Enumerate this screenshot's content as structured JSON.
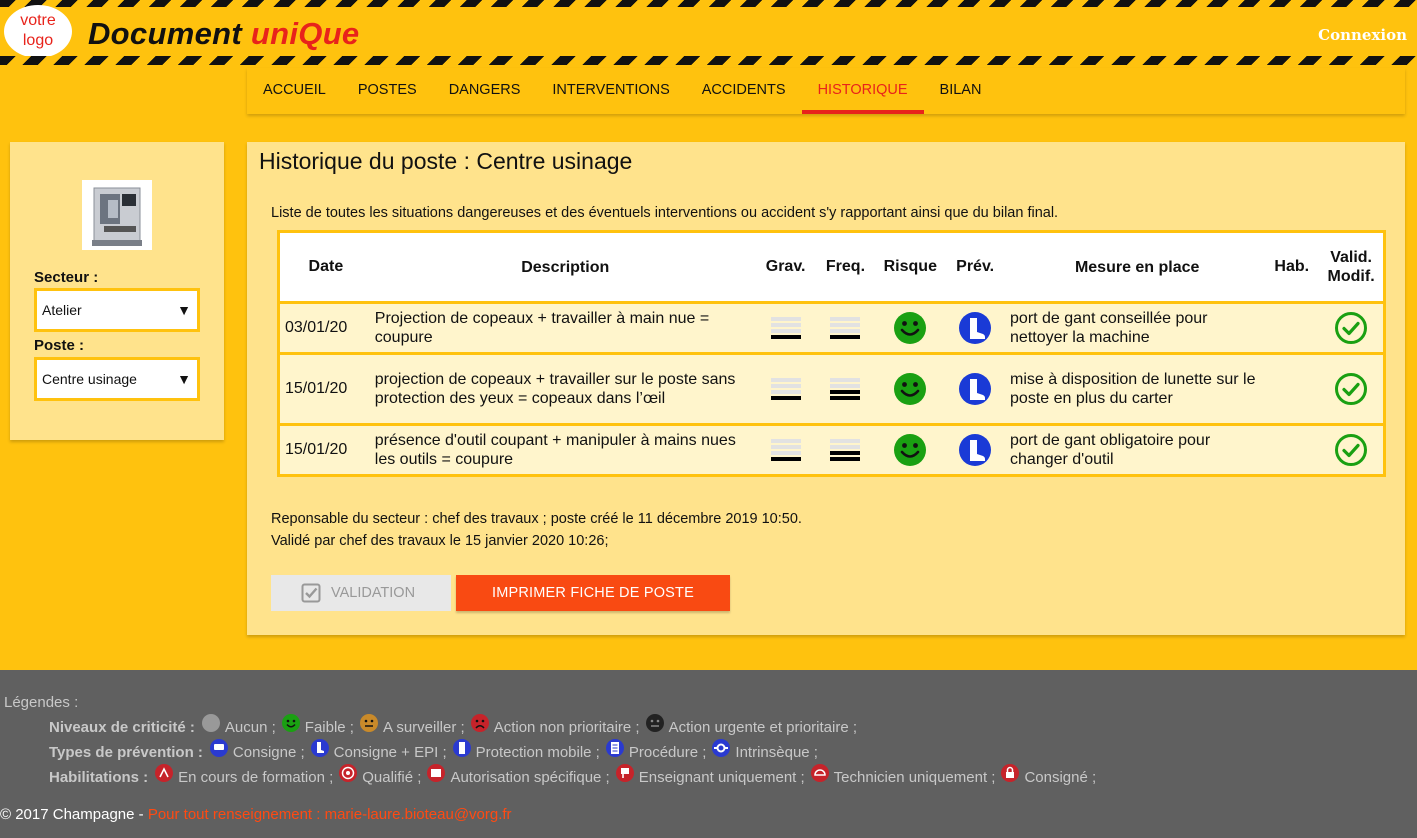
{
  "header": {
    "logo_line1": "votre",
    "logo_line2": "logo",
    "brand_part1": "Document ",
    "brand_part2": "uniQue",
    "login": "Connexion"
  },
  "nav": {
    "items": [
      "ACCUEIL",
      "POSTES",
      "DANGERS",
      "INTERVENTIONS",
      "ACCIDENTS",
      "HISTORIQUE",
      "BILAN"
    ],
    "active": "HISTORIQUE"
  },
  "sidebar": {
    "secteur_label": "Secteur :",
    "secteur_value": "Atelier",
    "poste_label": "Poste :",
    "poste_value": "Centre usinage",
    "caret": "▼"
  },
  "main": {
    "title": "Historique du poste : Centre usinage",
    "intro": "Liste de toutes les situations dangereuses et des éventuels interventions ou accident s'y rapportant ainsi que du bilan final.",
    "columns": {
      "date": "Date",
      "description": "Description",
      "grav": "Grav.",
      "freq": "Freq.",
      "risque": "Risque",
      "prev": "Prév.",
      "mesure": "Mesure en place",
      "hab": "Hab.",
      "valid1": "Valid.",
      "valid2": "Modif."
    },
    "rows": [
      {
        "date": "03/01/20",
        "description": "Projection de copeaux + travailler à main nue = coupure",
        "grav": 1,
        "freq": 1,
        "risque": "faible",
        "prev": "consigne-epi",
        "mesure": "port de gant conseillée pour nettoyer la machine"
      },
      {
        "date": "15/01/20",
        "description": "projection de copeaux + travailler sur le poste sans protection des yeux = copeaux dans l’œil",
        "grav": 1,
        "freq": 2,
        "risque": "faible",
        "prev": "consigne-epi",
        "mesure": "mise à disposition de lunette sur le poste en plus du carter"
      },
      {
        "date": "15/01/20",
        "description": "présence d'outil coupant + manipuler à mains nues les outils = coupure",
        "grav": 1,
        "freq": 2,
        "risque": "faible",
        "prev": "consigne-epi",
        "mesure": "port de gant obligatoire pour changer d'outil"
      }
    ],
    "responsable": "Reponsable du secteur : chef des travaux ; poste créé le 11 décembre 2019 10:50.",
    "valide": "Validé par chef des travaux le 15 janvier 2020 10:26;",
    "btn_validation": "VALIDATION",
    "btn_print": "IMPRIMER FICHE DE POSTE"
  },
  "legend": {
    "title": "Légendes :",
    "criticite_label": "Niveaux de criticité :",
    "criticite": [
      "Aucun ;",
      "Faible ;",
      "A surveiller ;",
      "Action non prioritaire ;",
      "Action urgente et prioritaire ;"
    ],
    "prevention_label": "Types de prévention :",
    "prevention": [
      "Consigne ;",
      "Consigne + EPI ;",
      "Protection mobile ;",
      "Procédure ;",
      "Intrinsèque ;"
    ],
    "habilitations_label": "Habilitations :",
    "habilitations": [
      "En cours de formation ;",
      "Qualifié ;",
      "Autorisation spécifique ;",
      "Enseignant uniquement ;",
      "Technicien uniquement ;",
      "Consigné ;"
    ],
    "copyright": "© 2017 Champagne - ",
    "contact": "Pour tout renseignement : marie-laure.bioteau@vorg.fr"
  },
  "colors": {
    "brand_yellow": "#ffc20e",
    "accent_red": "#e8231b",
    "button_orange": "#f94a12",
    "risk_green": "#1aa012",
    "prev_blue": "#1a3ad6"
  }
}
